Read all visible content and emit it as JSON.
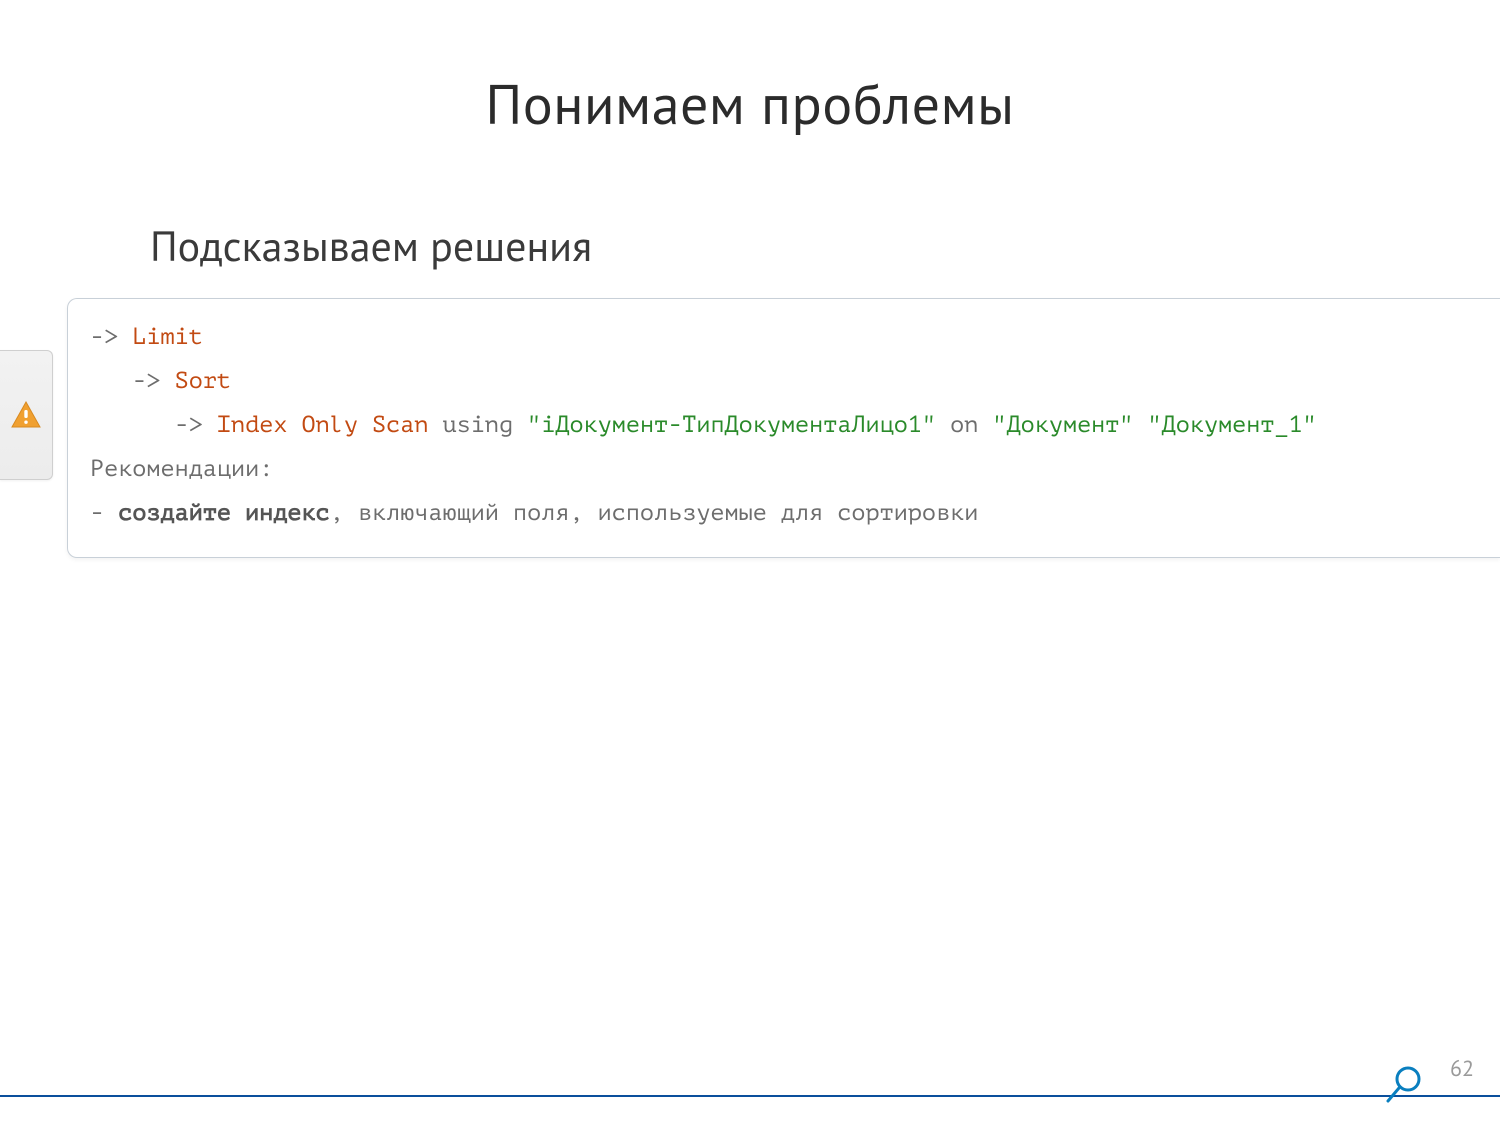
{
  "title": "Понимаем проблемы",
  "subtitle": "Подсказываем решения",
  "plan": {
    "arrow": "->",
    "limit": "Limit",
    "sort": "Sort",
    "index_only_scan": "Index Only Scan",
    "using": "using",
    "on": "on",
    "idx_name": "\"iДокумент-ТипДокументаЛицо1\"",
    "rel_name": "\"Документ\"",
    "alias": "\"Документ_1\""
  },
  "recommendations": {
    "label": "Рекомендации:",
    "bullet": "-",
    "strong": "создайте индекс",
    "rest": ", включающий поля, используемые для сортировки"
  },
  "page_number": "62",
  "colors": {
    "keyword": "#c24a12",
    "string": "#2a8a2a",
    "accent": "#0a4f9c",
    "warn": "#f0a030"
  }
}
